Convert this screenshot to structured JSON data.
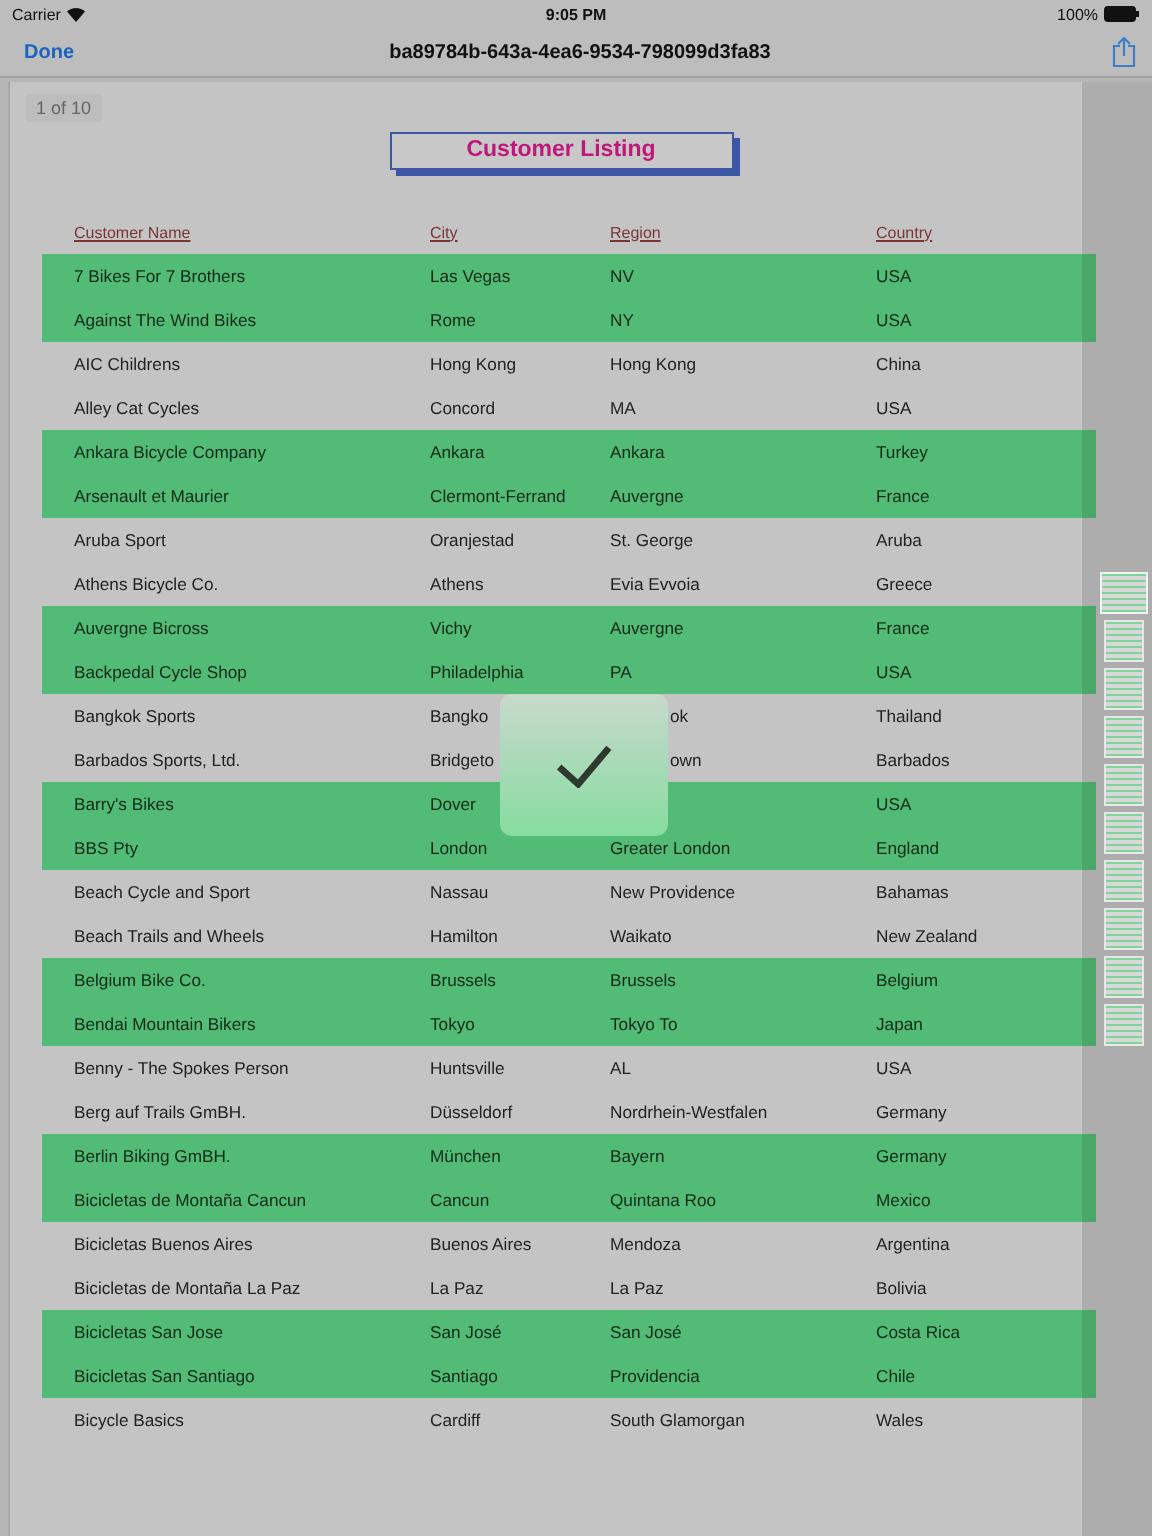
{
  "status_bar": {
    "carrier": "Carrier",
    "time": "9:05 PM",
    "battery": "100%"
  },
  "nav_bar": {
    "done": "Done",
    "title": "ba89784b-643a-4ea6-9534-798099d3fa83"
  },
  "document": {
    "page_indicator": "1 of 10",
    "title": "Customer Listing",
    "columns": [
      "Customer Name",
      "City",
      "Region",
      "Country"
    ],
    "rows": [
      {
        "selected": true,
        "covered": false,
        "name": "7 Bikes For 7 Brothers",
        "city": "Las Vegas",
        "region": "NV",
        "country": "USA"
      },
      {
        "selected": true,
        "covered": false,
        "name": "Against The Wind Bikes",
        "city": "Rome",
        "region": "NY",
        "country": "USA"
      },
      {
        "selected": false,
        "covered": false,
        "name": "AIC Childrens",
        "city": "Hong Kong",
        "region": "Hong Kong",
        "country": "China"
      },
      {
        "selected": false,
        "covered": false,
        "name": "Alley Cat Cycles",
        "city": "Concord",
        "region": "MA",
        "country": "USA"
      },
      {
        "selected": true,
        "covered": false,
        "name": "Ankara Bicycle Company",
        "city": "Ankara",
        "region": "Ankara",
        "country": "Turkey"
      },
      {
        "selected": true,
        "covered": false,
        "name": "Arsenault et Maurier",
        "city": "Clermont-Ferrand",
        "region": "Auvergne",
        "country": "France"
      },
      {
        "selected": false,
        "covered": false,
        "name": "Aruba Sport",
        "city": "Oranjestad",
        "region": "St. George",
        "country": "Aruba"
      },
      {
        "selected": false,
        "covered": false,
        "name": "Athens Bicycle Co.",
        "city": "Athens",
        "region": "Evia Evvoia",
        "country": "Greece"
      },
      {
        "selected": true,
        "covered": false,
        "name": "Auvergne Bicross",
        "city": "Vichy",
        "region": "Auvergne",
        "country": "France"
      },
      {
        "selected": true,
        "covered": false,
        "name": "Backpedal Cycle Shop",
        "city": "Philadelphia",
        "region": "PA",
        "country": "USA"
      },
      {
        "selected": false,
        "covered": true,
        "name": "Bangkok Sports",
        "city": "Bangko",
        "region": "ok",
        "country": "Thailand"
      },
      {
        "selected": false,
        "covered": true,
        "name": "Barbados Sports, Ltd.",
        "city": "Bridgeto",
        "region": "own",
        "country": "Barbados"
      },
      {
        "selected": true,
        "covered": true,
        "name": "Barry's Bikes",
        "city": "Dover",
        "country": "USA"
      },
      {
        "selected": true,
        "covered": false,
        "name": "BBS Pty",
        "city": "London",
        "region": "Greater London",
        "country": "England"
      },
      {
        "selected": false,
        "covered": false,
        "name": "Beach Cycle and Sport",
        "city": "Nassau",
        "region": "New Providence",
        "country": "Bahamas"
      },
      {
        "selected": false,
        "covered": false,
        "name": "Beach Trails and Wheels",
        "city": "Hamilton",
        "region": "Waikato",
        "country": "New Zealand"
      },
      {
        "selected": true,
        "covered": false,
        "name": "Belgium Bike Co.",
        "city": "Brussels",
        "region": "Brussels",
        "country": "Belgium"
      },
      {
        "selected": true,
        "covered": false,
        "name": "Bendai Mountain Bikers",
        "city": "Tokyo",
        "region": "Tokyo To",
        "country": "Japan"
      },
      {
        "selected": false,
        "covered": false,
        "name": "Benny - The Spokes Person",
        "city": "Huntsville",
        "region": "AL",
        "country": "USA"
      },
      {
        "selected": false,
        "covered": false,
        "name": "Berg auf Trails GmBH.",
        "city": "Düsseldorf",
        "region": "Nordrhein-Westfalen",
        "country": "Germany"
      },
      {
        "selected": true,
        "covered": false,
        "name": "Berlin Biking GmBH.",
        "city": "München",
        "region": "Bayern",
        "country": "Germany"
      },
      {
        "selected": true,
        "covered": false,
        "name": "Bicicletas  de Montaña Cancun",
        "city": "Cancun",
        "region": "Quintana Roo",
        "country": "Mexico"
      },
      {
        "selected": false,
        "covered": false,
        "name": "Bicicletas Buenos Aires",
        "city": "Buenos Aires",
        "region": "Mendoza",
        "country": "Argentina"
      },
      {
        "selected": false,
        "covered": false,
        "name": "Bicicletas de Montaña La Paz",
        "city": "La Paz",
        "region": "La Paz",
        "country": "Bolivia"
      },
      {
        "selected": true,
        "covered": false,
        "name": "Bicicletas San Jose",
        "city": "San José",
        "region": "San José",
        "country": "Costa Rica"
      },
      {
        "selected": true,
        "covered": false,
        "name": "Bicicletas San Santiago",
        "city": "Santiago",
        "region": "Providencia",
        "country": "Chile"
      },
      {
        "selected": false,
        "covered": false,
        "name": "Bicycle Basics",
        "city": "Cardiff",
        "region": "South Glamorgan",
        "country": "Wales"
      }
    ]
  },
  "thumbnails": [
    {
      "selected": true
    },
    {
      "selected": false
    },
    {
      "selected": false
    },
    {
      "selected": false
    },
    {
      "selected": false
    },
    {
      "selected": false
    },
    {
      "selected": false
    },
    {
      "selected": false
    },
    {
      "selected": false
    },
    {
      "selected": false
    }
  ],
  "overlay": {
    "kind": "success"
  }
}
